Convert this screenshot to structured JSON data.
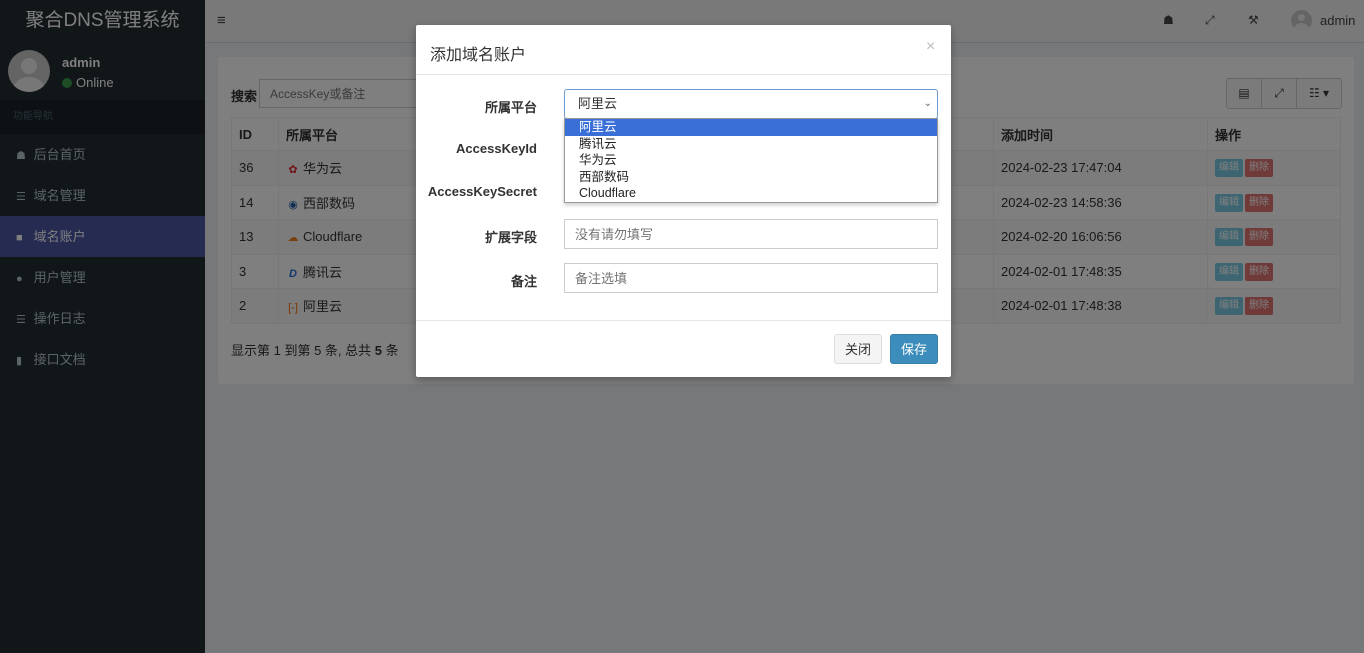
{
  "app": {
    "title": "聚合DNS管理系统"
  },
  "user": {
    "name": "admin",
    "status": "Online"
  },
  "sidebar": {
    "header": "功能导航",
    "items": [
      {
        "label": "后台首页",
        "icon": "home-icon"
      },
      {
        "label": "域名管理",
        "icon": "list-icon"
      },
      {
        "label": "域名账户",
        "icon": "lock-icon",
        "active": true
      },
      {
        "label": "用户管理",
        "icon": "user-icon"
      },
      {
        "label": "操作日志",
        "icon": "list-icon"
      },
      {
        "label": "接口文档",
        "icon": "book-icon"
      }
    ]
  },
  "navbar": {
    "user_label": "admin"
  },
  "search": {
    "label": "搜索",
    "placeholder": "AccessKey或备注"
  },
  "table": {
    "headers": {
      "id": "ID",
      "platform": "所属平台",
      "time": "添加时间",
      "ops": "操作"
    },
    "rows": [
      {
        "id": "36",
        "platform": "华为云",
        "icon": "huawei-icon",
        "time": "2024-02-23 17:47:04"
      },
      {
        "id": "14",
        "platform": "西部数码",
        "icon": "west-digital-icon",
        "time": "2024-02-23 14:58:36"
      },
      {
        "id": "13",
        "platform": "Cloudflare",
        "icon": "cloudflare-icon",
        "time": "2024-02-20 16:06:56"
      },
      {
        "id": "3",
        "platform": "腾讯云",
        "icon": "tencent-icon",
        "time": "2024-02-01 17:48:35"
      },
      {
        "id": "2",
        "platform": "阿里云",
        "icon": "aliyun-icon",
        "time": "2024-02-01 17:48:38"
      }
    ],
    "edit_label": "编辑",
    "delete_label": "删除"
  },
  "pager": {
    "prefix": "显示第 1 到第 5 条, 总共 ",
    "total": "5",
    "suffix": " 条"
  },
  "modal": {
    "title": "添加域名账户",
    "close_symbol": "×",
    "fields": {
      "platform_label": "所属平台",
      "platform_value": "阿里云",
      "accesskeyid_label": "AccessKeyId",
      "accesskeysecret_label": "AccessKeySecret",
      "ext_label": "扩展字段",
      "ext_placeholder": "没有请勿填写",
      "remark_label": "备注",
      "remark_placeholder": "备注选填"
    },
    "options": [
      "阿里云",
      "腾讯云",
      "华为云",
      "西部数码",
      "Cloudflare"
    ],
    "close_btn": "关闭",
    "save_btn": "保存"
  }
}
